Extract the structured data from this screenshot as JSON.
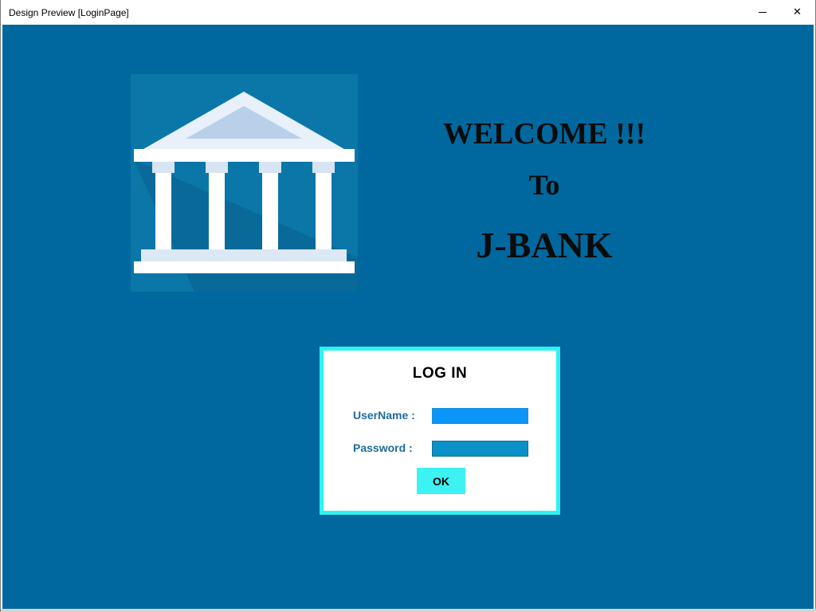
{
  "window": {
    "title": "Design Preview [LoginPage]",
    "minimize_icon": "minimize-icon",
    "close_icon": "close-icon",
    "close_glyph": "✕"
  },
  "welcome": {
    "line1": "WELCOME !!!",
    "line2": "To",
    "line3": "J-BANK"
  },
  "logo": {
    "icon": "bank-building-icon"
  },
  "login": {
    "title": "LOG IN",
    "username_label": "UserName :",
    "username_value": "",
    "password_label": "Password :",
    "password_value": "",
    "ok_label": "OK"
  },
  "colors": {
    "background": "#00689e",
    "login_border": "#2ef2f2",
    "ok_button": "#3df2f2",
    "label": "#1d6c9a",
    "username_field": "#0a96f8",
    "password_field": "#0a92c8"
  }
}
